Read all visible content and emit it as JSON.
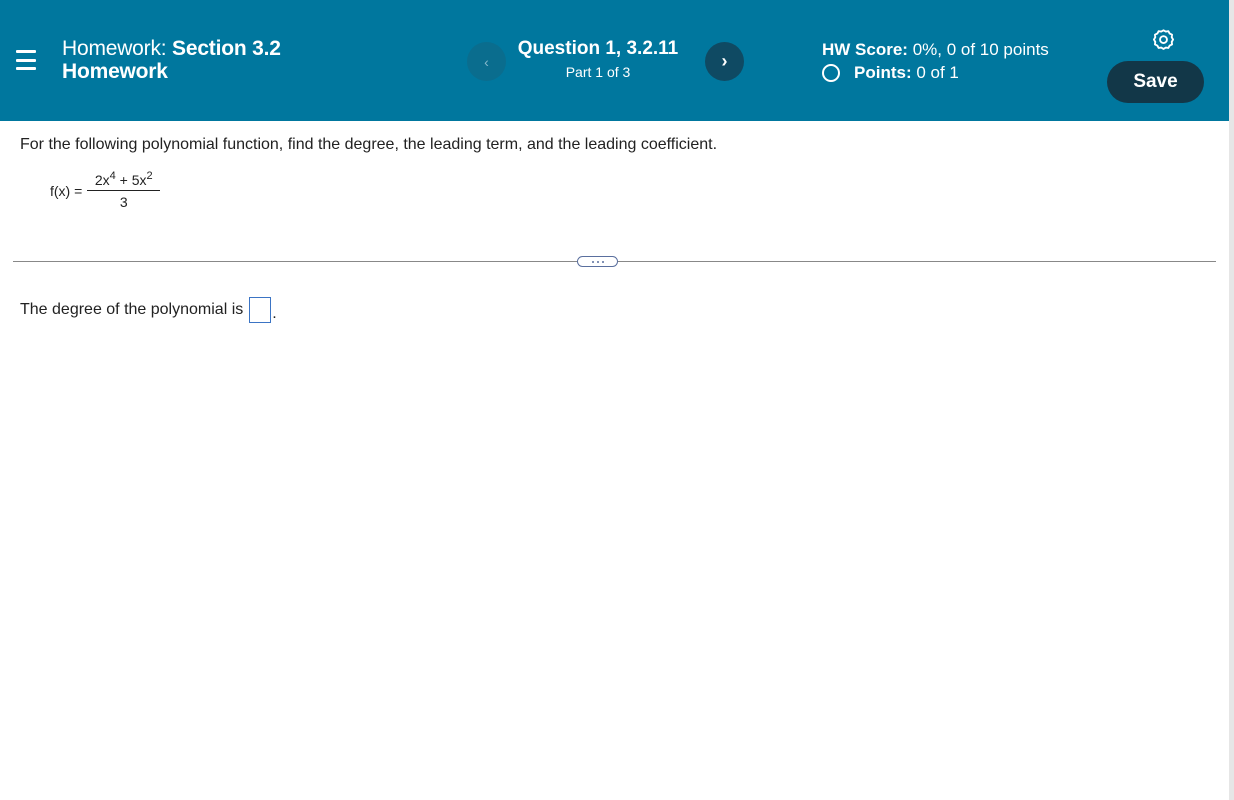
{
  "header": {
    "menu_icon": "hamburger-menu-icon",
    "title_prefix": "Homework:",
    "title_section": "Section 3.2",
    "title_rest": "Homework",
    "prev_label": "‹",
    "next_label": "›",
    "question_title": "Question 1, 3.2.11",
    "question_part": "Part 1 of 3",
    "hw_score_label": "HW Score:",
    "hw_score_value": "0%, 0 of 10 points",
    "points_label": "Points:",
    "points_value": "0 of 1",
    "settings_icon": "gear-icon",
    "save_label": "Save"
  },
  "colors": {
    "header_bg": "#00779e",
    "save_bg": "#123748",
    "answer_border": "#3b74c4"
  },
  "content": {
    "instructions": "For the following polynomial function, find the degree, the leading term, and the leading coefficient.",
    "formula": {
      "lhs": "f(x) =",
      "num_term1": "2x",
      "num_exp1": "4",
      "num_op": " + 5x",
      "num_exp2": "2",
      "denominator": "3"
    },
    "expand_icon": "ellipsis-icon",
    "answer_prompt": "The degree of the polynomial is",
    "answer_value": "",
    "answer_suffix": "."
  }
}
